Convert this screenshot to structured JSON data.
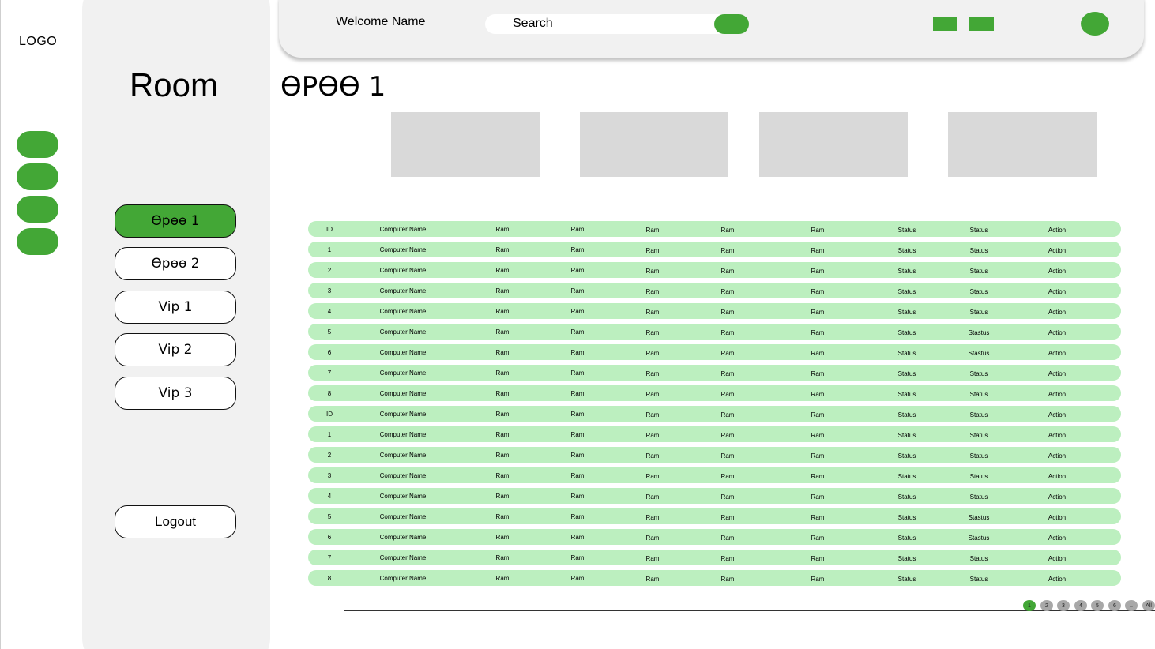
{
  "logo": "LOGO",
  "sidebar": {
    "title": "Room",
    "rooms": [
      {
        "label": "Өрөө 1",
        "active": true
      },
      {
        "label": "Өрөө 2",
        "active": false
      },
      {
        "label": "Vip 1",
        "active": false
      },
      {
        "label": "Vip 2",
        "active": false
      },
      {
        "label": "Vip 3",
        "active": false
      }
    ],
    "logout_label": "Logout"
  },
  "header": {
    "welcome": "Welcome Name",
    "search_placeholder": "Search"
  },
  "page_title": "ӨРӨӨ 1",
  "colors": {
    "accent": "#43a736",
    "row_bg": "#bcefbf",
    "panel_bg": "#f1f1f1",
    "card_bg": "#d9d9d9"
  },
  "table": {
    "rows": [
      [
        "ID",
        "Computer Name",
        "Ram",
        "Ram",
        "Ram",
        "Ram",
        "Ram",
        "Status",
        "Status",
        "Action"
      ],
      [
        "1",
        "Computer Name",
        "Ram",
        "Ram",
        "Ram",
        "Ram",
        "Ram",
        "Status",
        "Status",
        "Action"
      ],
      [
        "2",
        "Computer Name",
        "Ram",
        "Ram",
        "Ram",
        "Ram",
        "Ram",
        "Status",
        "Status",
        "Action"
      ],
      [
        "3",
        "Computer Name",
        "Ram",
        "Ram",
        "Ram",
        "Ram",
        "Ram",
        "Status",
        "Status",
        "Action"
      ],
      [
        "4",
        "Computer Name",
        "Ram",
        "Ram",
        "Ram",
        "Ram",
        "Ram",
        "Status",
        "Status",
        "Action"
      ],
      [
        "5",
        "Computer Name",
        "Ram",
        "Ram",
        "Ram",
        "Ram",
        "Ram",
        "Status",
        "Stastus",
        "Action"
      ],
      [
        "6",
        "Computer Name",
        "Ram",
        "Ram",
        "Ram",
        "Ram",
        "Ram",
        "Status",
        "Stastus",
        "Action"
      ],
      [
        "7",
        "Computer Name",
        "Ram",
        "Ram",
        "Ram",
        "Ram",
        "Ram",
        "Status",
        "Status",
        "Action"
      ],
      [
        "8",
        "Computer Name",
        "Ram",
        "Ram",
        "Ram",
        "Ram",
        "Ram",
        "Status",
        "Status",
        "Action"
      ],
      [
        "ID",
        "Computer Name",
        "Ram",
        "Ram",
        "Ram",
        "Ram",
        "Ram",
        "Status",
        "Status",
        "Action"
      ],
      [
        "1",
        "Computer Name",
        "Ram",
        "Ram",
        "Ram",
        "Ram",
        "Ram",
        "Status",
        "Status",
        "Action"
      ],
      [
        "2",
        "Computer Name",
        "Ram",
        "Ram",
        "Ram",
        "Ram",
        "Ram",
        "Status",
        "Status",
        "Action"
      ],
      [
        "3",
        "Computer Name",
        "Ram",
        "Ram",
        "Ram",
        "Ram",
        "Ram",
        "Status",
        "Status",
        "Action"
      ],
      [
        "4",
        "Computer Name",
        "Ram",
        "Ram",
        "Ram",
        "Ram",
        "Ram",
        "Status",
        "Status",
        "Action"
      ],
      [
        "5",
        "Computer Name",
        "Ram",
        "Ram",
        "Ram",
        "Ram",
        "Ram",
        "Status",
        "Stastus",
        "Action"
      ],
      [
        "6",
        "Computer Name",
        "Ram",
        "Ram",
        "Ram",
        "Ram",
        "Ram",
        "Status",
        "Stastus",
        "Action"
      ],
      [
        "7",
        "Computer Name",
        "Ram",
        "Ram",
        "Ram",
        "Ram",
        "Ram",
        "Status",
        "Status",
        "Action"
      ],
      [
        "8",
        "Computer Name",
        "Ram",
        "Ram",
        "Ram",
        "Ram",
        "Ram",
        "Status",
        "Status",
        "Action"
      ]
    ]
  },
  "pagination": {
    "pages": [
      "1",
      "2",
      "3",
      "4",
      "5",
      "6",
      "..",
      "All"
    ],
    "current": "1"
  }
}
